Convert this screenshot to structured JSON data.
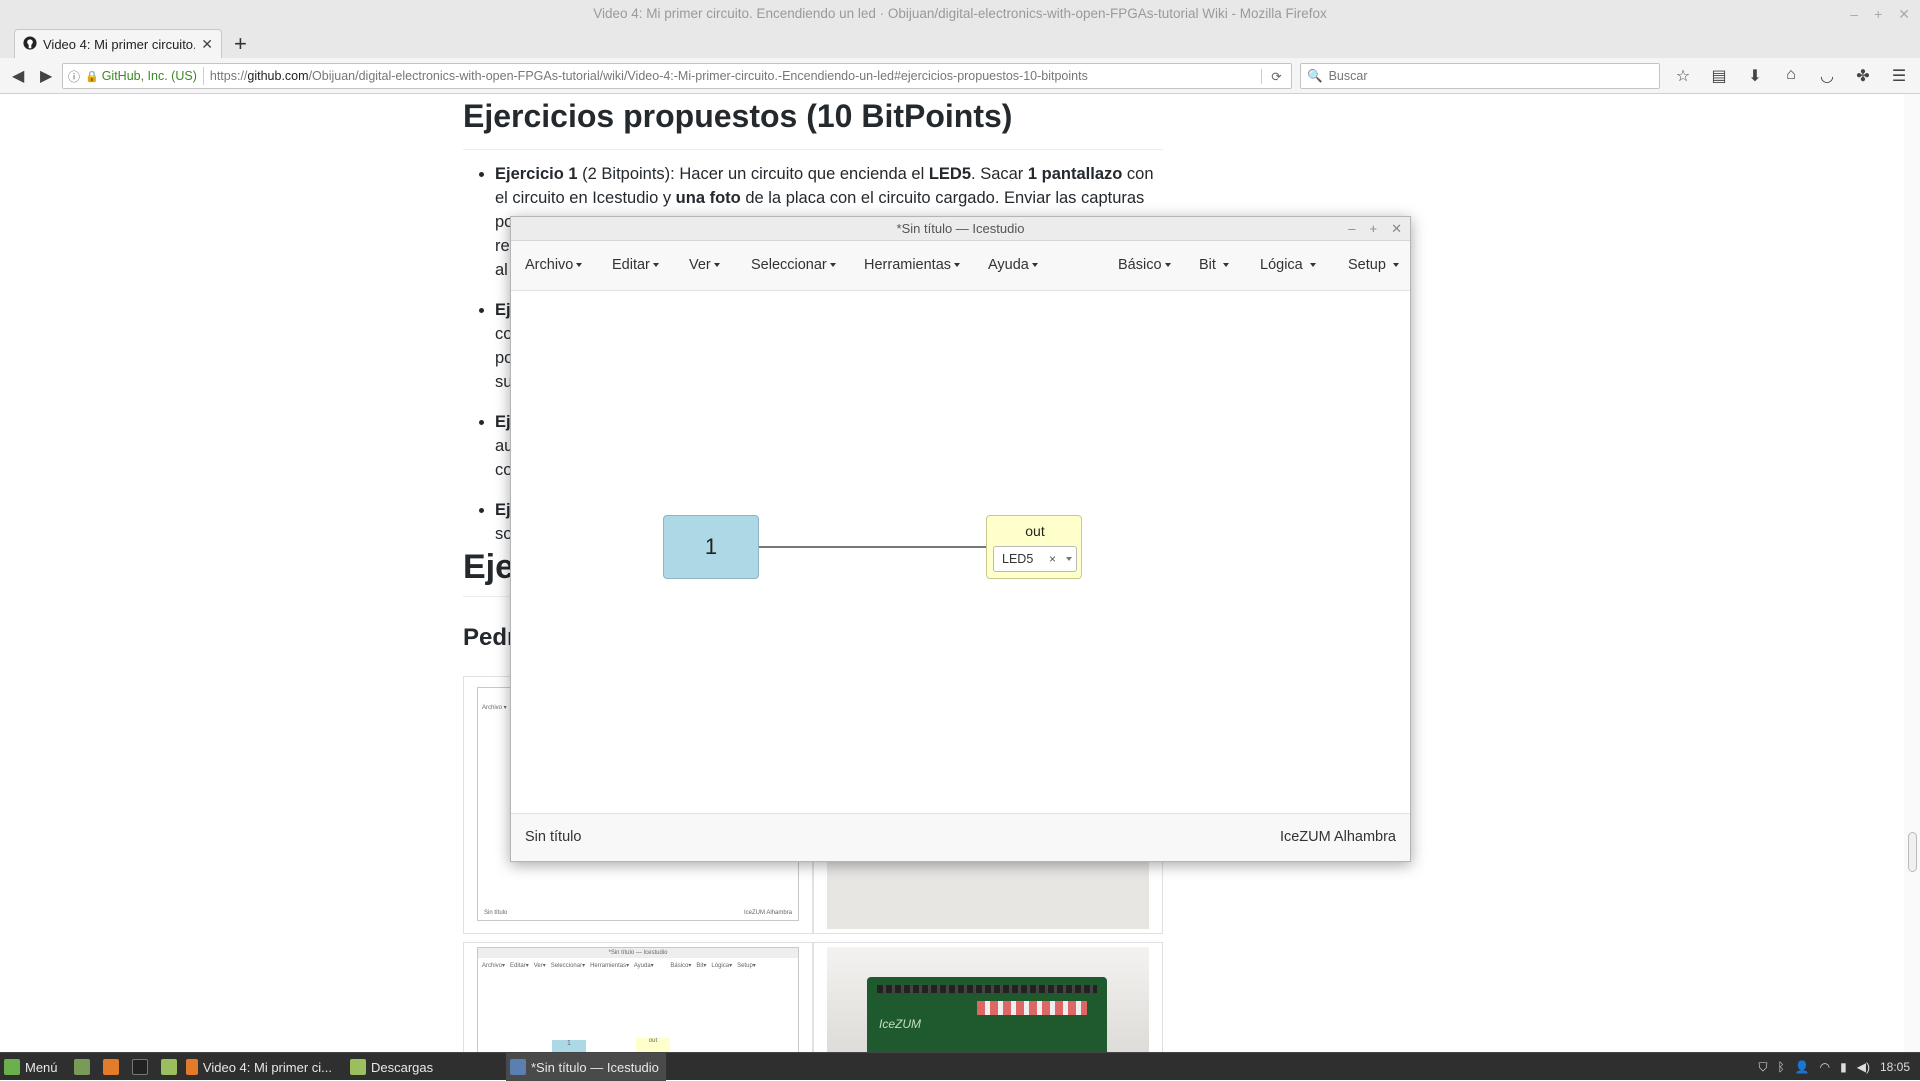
{
  "window_title": "Video 4: Mi primer circuito. Encendiendo un led · Obijuan/digital-electronics-with-open-FPGAs-tutorial Wiki - Mozilla Firefox",
  "browser": {
    "tab_title": "Video 4: Mi primer circuito.",
    "url_identity": "GitHub, Inc. (US)",
    "url_prefix": "https://",
    "url_host": "github.com",
    "url_path": "/Obijuan/digital-electronics-with-open-FPGAs-tutorial/wiki/Video-4:-Mi-primer-circuito.-Encendiendo-un-led#ejercicios-propuestos-10-bitpoints",
    "search_placeholder": "Buscar"
  },
  "page": {
    "heading": "Ejercicios propuestos (10 BitPoints)",
    "exercise1": {
      "title": "Ejercicio 1",
      "points": " (2 Bitpoints): Hacer un circuito que encienda el ",
      "led": "LED5",
      "t1": ". Sacar ",
      "b1": "1 pantallazo",
      "t2": " con el circuito en Icestudio y ",
      "b2": "una foto",
      "t3": " de la placa con el circuito cargado. Enviar las capturas por",
      "line3": "re",
      "line4": "al"
    },
    "exercise2_lines": [
      "Ej",
      "co",
      "po",
      "su"
    ],
    "exercise3_lines": [
      "Ej",
      "au",
      "co"
    ],
    "exercise4_lines": [
      "Ej",
      "so"
    ],
    "heading2": "Eje",
    "heading3": "Pedr",
    "thumb1": {
      "menu": "Archivo ▾",
      "footer_left": "Sin título",
      "footer_right": "IceZUM Alhambra"
    },
    "thumb2": {
      "title": "*Sin título — Icestudio",
      "menu": "Archivo▾   Editar▾   Ver▾   Seleccionar▾   Herramientas▾   Ayuda▾          Básico▾   Bit▾   Lógica▾   Setup▾",
      "const": "1",
      "out": "out"
    },
    "board_label": "IceZUM"
  },
  "icestudio": {
    "title": "*Sin título — Icestudio",
    "menus_left": [
      "Archivo",
      "Editar",
      "Ver",
      "Seleccionar",
      "Herramientas",
      "Ayuda"
    ],
    "menus_right": [
      "Básico",
      "Bit",
      "Lógica",
      "Setup"
    ],
    "const_value": "1",
    "output_label": "out",
    "output_pin": "LED5",
    "status_left": "Sin título",
    "status_right": "IceZUM Alhambra"
  },
  "taskbar": {
    "menu_label": "Menú",
    "items": [
      "Video 4: Mi primer ci...",
      "Descargas",
      "*Sin título — Icestudio"
    ],
    "clock": "18:05"
  }
}
